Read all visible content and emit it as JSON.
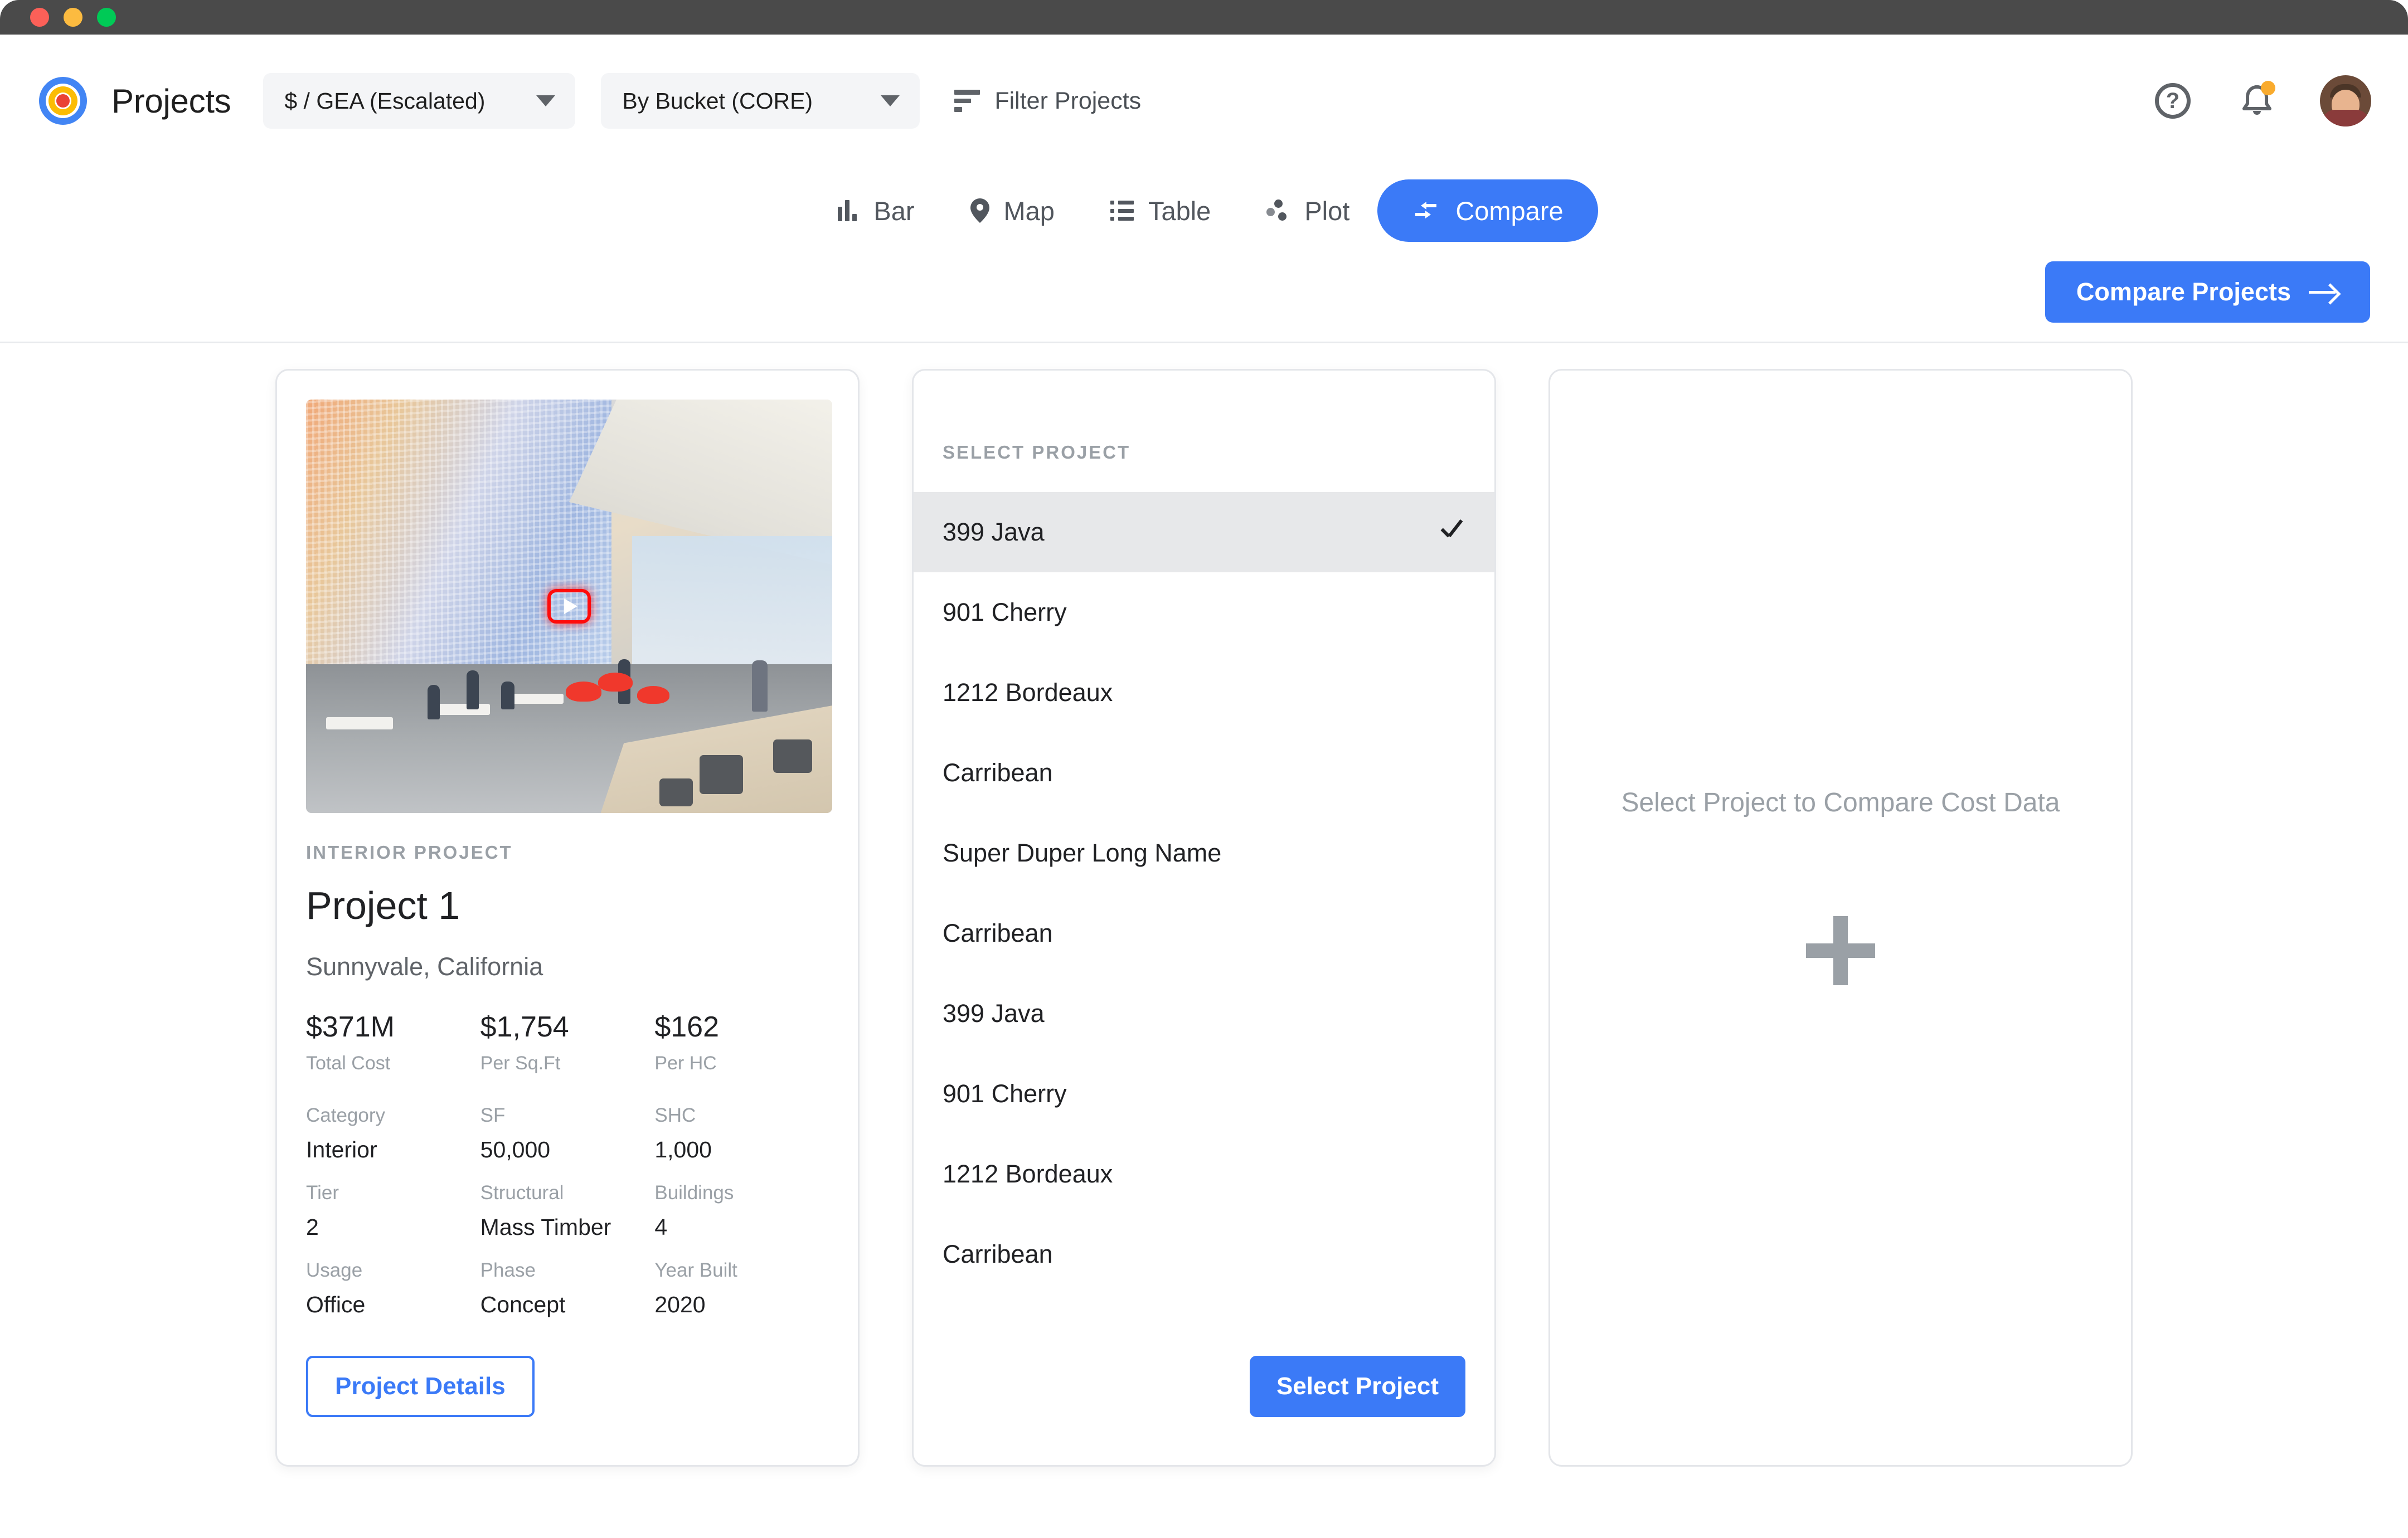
{
  "window": {
    "traffic_lights": [
      "close",
      "minimize",
      "maximize"
    ]
  },
  "header": {
    "app_title": "Projects",
    "logo_icon": "target-logo-icon",
    "metric_select": {
      "value": "$ / GEA (Escalated)",
      "icon": "chevron-down-icon"
    },
    "grouping_select": {
      "value": "By Bucket (CORE)",
      "icon": "chevron-down-icon"
    },
    "filter": {
      "label": "Filter Projects",
      "icon": "filter-icon"
    },
    "help_icon": "question-mark-circle-icon",
    "help_glyph": "?",
    "notifications_icon": "bell-icon",
    "notification_badge": true,
    "avatar_icon": "user-avatar"
  },
  "tabs": [
    {
      "label": "Bar",
      "icon": "bar-chart-icon",
      "active": false
    },
    {
      "label": "Map",
      "icon": "map-pin-icon",
      "active": false
    },
    {
      "label": "Table",
      "icon": "list-table-icon",
      "active": false
    },
    {
      "label": "Plot",
      "icon": "scatter-plot-icon",
      "active": false
    },
    {
      "label": "Compare",
      "icon": "compare-arrows-icon",
      "active": true
    }
  ],
  "subbar": {
    "compare_projects_label": "Compare Projects",
    "compare_projects_icon": "arrow-right-icon"
  },
  "project_card": {
    "photo_icon": "project-photo",
    "play_icon": "play-button-icon",
    "eyebrow": "INTERIOR PROJECT",
    "name": "Project 1",
    "location": "Sunnyvale, California",
    "metrics": [
      {
        "value": "$371M",
        "label": "Total Cost"
      },
      {
        "value": "$1,754",
        "label": "Per Sq.Ft"
      },
      {
        "value": "$162",
        "label": "Per HC"
      }
    ],
    "specs": [
      [
        {
          "key": "Category",
          "value": "Interior"
        },
        {
          "key": "SF",
          "value": "50,000"
        },
        {
          "key": "SHC",
          "value": "1,000"
        }
      ],
      [
        {
          "key": "Tier",
          "value": "2"
        },
        {
          "key": "Structural",
          "value": "Mass Timber"
        },
        {
          "key": "Buildings",
          "value": "4"
        }
      ],
      [
        {
          "key": "Usage",
          "value": "Office"
        },
        {
          "key": "Phase",
          "value": "Concept"
        },
        {
          "key": "Year Built",
          "value": "2020"
        }
      ]
    ],
    "details_button": "Project Details"
  },
  "select_card": {
    "heading": "SELECT PROJECT",
    "items": [
      {
        "label": "399 Java",
        "selected": true
      },
      {
        "label": "901 Cherry",
        "selected": false
      },
      {
        "label": "1212 Bordeaux",
        "selected": false
      },
      {
        "label": "Carribean",
        "selected": false
      },
      {
        "label": "Super Duper Long Name",
        "selected": false
      },
      {
        "label": "Carribean",
        "selected": false
      },
      {
        "label": "399 Java",
        "selected": false
      },
      {
        "label": "901 Cherry",
        "selected": false
      },
      {
        "label": "1212 Bordeaux",
        "selected": false
      },
      {
        "label": "Carribean",
        "selected": false
      }
    ],
    "check_icon": "checkmark-icon",
    "select_button": "Select Project"
  },
  "empty_card": {
    "title": "Select Project to Compare Cost Data",
    "add_icon": "plus-icon"
  },
  "colors": {
    "accent_blue": "#3b7af7",
    "logo_blue": "#4285f4",
    "logo_orange": "#fbbc05",
    "logo_red": "#ea4335",
    "notification_orange": "#f9ab2e",
    "muted_text": "#9aa0a6",
    "body_text": "#202124",
    "card_border": "#e4e6ea",
    "selected_row": "#e7e8ea",
    "titlebar": "#4a4a4a"
  }
}
